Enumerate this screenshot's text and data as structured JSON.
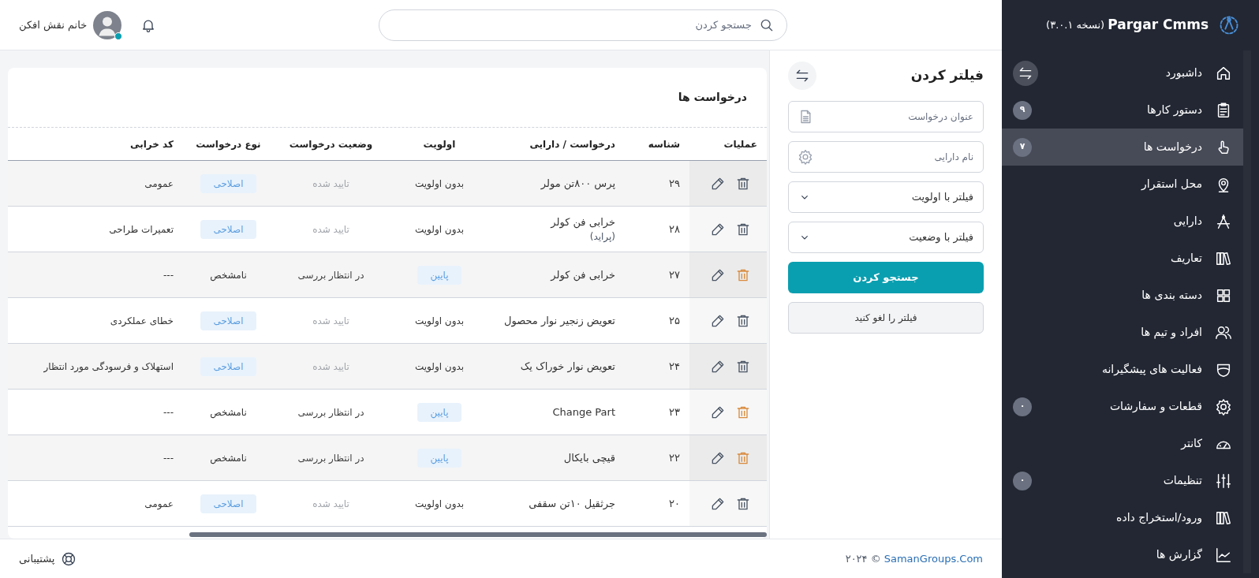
{
  "header": {
    "search": {
      "placeholder": "جستجو کردن"
    },
    "user": {
      "name": "خانم نقش افکن",
      "online": true
    }
  },
  "sidebar": {
    "brand": "Pargar Cmms",
    "version": "(نسخه ۳.۰.۱)",
    "items": [
      {
        "kind": "home",
        "label": "داشبورد",
        "selected": false
      },
      {
        "kind": "clipboard",
        "label": "دستور کارها",
        "badge": "۹",
        "selected": false
      },
      {
        "kind": "hand",
        "label": "درخواست ها",
        "badge": "۷",
        "selected": true
      },
      {
        "kind": "pin",
        "label": "محل استقرار",
        "selected": false
      },
      {
        "kind": "compass",
        "label": "دارایی",
        "selected": false
      },
      {
        "kind": "books",
        "label": "تعاریف",
        "selected": false
      },
      {
        "kind": "grid",
        "label": "دسته بندی ها",
        "selected": false
      },
      {
        "kind": "people",
        "label": "افراد و تیم ها",
        "selected": false
      },
      {
        "kind": "shield",
        "label": "فعالیت های پیشگیرانه",
        "selected": false
      },
      {
        "kind": "gear",
        "label": "قطعات و سفارشات",
        "badge": "۰",
        "selected": false
      },
      {
        "kind": "gauge",
        "label": "کانتر",
        "selected": false
      },
      {
        "kind": "sliders",
        "label": "تنظیمات",
        "badge": "۰",
        "selected": false
      },
      {
        "kind": "books",
        "label": "ورود/استخراج داده",
        "selected": false
      },
      {
        "kind": "chart",
        "label": "گزارش ها",
        "selected": false
      }
    ]
  },
  "filter": {
    "title": "فیلتر کردن",
    "fields": [
      {
        "kind": "text",
        "placeholder": "عنوان درخواست"
      },
      {
        "kind": "text",
        "placeholder": "نام دارایی"
      },
      {
        "kind": "select",
        "value": "فیلتر با اولویت"
      },
      {
        "kind": "select",
        "value": "فیلتر با وضعیت"
      }
    ],
    "search_button": "جستجو کردن",
    "cancel_button": "فیلتر را لغو کنید"
  },
  "table": {
    "title": "درخواست ها",
    "columns": [
      "عملیات",
      "شناسه",
      "درخواست / دارایی",
      "اولویت",
      "وضعیت درخواست",
      "نوع درخواست",
      "کد خرابی"
    ],
    "rows": [
      {
        "id": "۲۹",
        "title": "پرس ۸۰۰تن مولر",
        "priority": {
          "text": "بدون اولویت",
          "kind": "plain"
        },
        "status": {
          "text": "تایید شده",
          "kind": "approved"
        },
        "type": {
          "text": "اصلاحی",
          "kind": "badge"
        },
        "fault": "عمومی",
        "delete_active": false
      },
      {
        "id": "۲۸",
        "title": "خرابی فن کولر",
        "subtitle": "(پراید)",
        "priority": {
          "text": "بدون اولویت",
          "kind": "plain"
        },
        "status": {
          "text": "تایید شده",
          "kind": "approved"
        },
        "type": {
          "text": "اصلاحی",
          "kind": "badge"
        },
        "fault": "تعمیرات طراحی",
        "delete_active": false
      },
      {
        "id": "۲۷",
        "title": "خرابی فن کولر",
        "priority": {
          "text": "پایین",
          "kind": "badge"
        },
        "status": {
          "text": "در انتظار بررسی",
          "kind": "pending"
        },
        "type": {
          "text": "نامشخص",
          "kind": "plain"
        },
        "fault": "---",
        "delete_active": true
      },
      {
        "id": "۲۵",
        "title": "تعویض زنجیر نوار محصول",
        "priority": {
          "text": "بدون اولویت",
          "kind": "plain"
        },
        "status": {
          "text": "تایید شده",
          "kind": "approved"
        },
        "type": {
          "text": "اصلاحی",
          "kind": "badge"
        },
        "fault": "خطای عملکردی",
        "delete_active": false
      },
      {
        "id": "۲۴",
        "title": "تعویض نوار خوراک یک",
        "priority": {
          "text": "بدون اولویت",
          "kind": "plain"
        },
        "status": {
          "text": "تایید شده",
          "kind": "approved"
        },
        "type": {
          "text": "اصلاحی",
          "kind": "badge"
        },
        "fault": "استهلاک و فرسودگی مورد انتظار",
        "delete_active": false
      },
      {
        "id": "۲۳",
        "title": "Change Part",
        "priority": {
          "text": "پایین",
          "kind": "badge"
        },
        "status": {
          "text": "در انتظار بررسی",
          "kind": "pending"
        },
        "type": {
          "text": "نامشخص",
          "kind": "plain"
        },
        "fault": "---",
        "delete_active": true
      },
      {
        "id": "۲۲",
        "title": "قیچی بایکال",
        "priority": {
          "text": "پایین",
          "kind": "badge"
        },
        "status": {
          "text": "در انتظار بررسی",
          "kind": "pending"
        },
        "type": {
          "text": "نامشخص",
          "kind": "plain"
        },
        "fault": "---",
        "delete_active": true
      },
      {
        "id": "۲۰",
        "title": "جرثقیل ۱۰تن سقفی",
        "priority": {
          "text": "بدون اولویت",
          "kind": "plain"
        },
        "status": {
          "text": "تایید شده",
          "kind": "approved"
        },
        "type": {
          "text": "اصلاحی",
          "kind": "badge"
        },
        "fault": "عمومی",
        "delete_active": false
      }
    ]
  },
  "footer": {
    "copyright_link": "SamanGroups.Com",
    "copyright_text": "© ۲۰۲۴",
    "support": "پشتیبانی"
  }
}
